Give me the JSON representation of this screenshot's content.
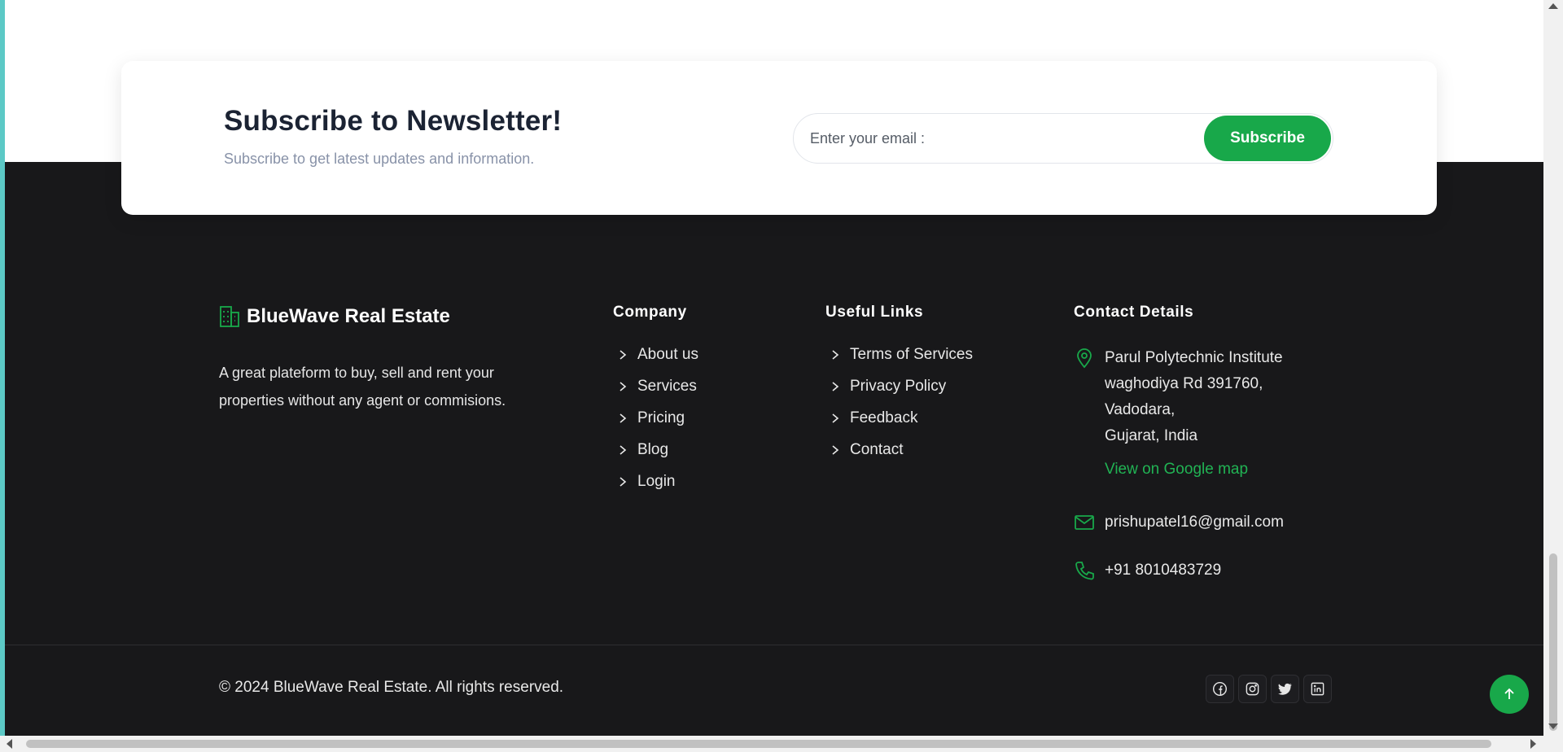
{
  "newsletter": {
    "title": "Subscribe to Newsletter!",
    "subtitle": "Subscribe to get latest updates and information.",
    "email_placeholder": "Enter your email :",
    "button_label": "Subscribe"
  },
  "brand": {
    "name": "BlueWave Real Estate",
    "icon": "building-icon",
    "description": "A great plateform to buy, sell and rent your properties without any agent or commisions."
  },
  "company": {
    "title": "Company",
    "links": [
      "About us",
      "Services",
      "Pricing",
      "Blog",
      "Login"
    ]
  },
  "useful_links": {
    "title": "Useful Links",
    "links": [
      "Terms of Services",
      "Privacy Policy",
      "Feedback",
      "Contact"
    ]
  },
  "contact": {
    "title": "Contact Details",
    "address_lines": [
      "Parul Polytechnic Institute",
      "waghodiya Rd 391760,",
      "Vadodara,",
      "Gujarat, India"
    ],
    "map_link": "View on Google map",
    "email": "prishupatel16@gmail.com",
    "phone": "+91 8010483729"
  },
  "footer_bottom": {
    "copyright": "© 2024 BlueWave Real Estate. All rights reserved.",
    "socials": [
      "facebook-icon",
      "instagram-icon",
      "twitter-icon",
      "linkedin-icon"
    ]
  },
  "colors": {
    "accent": "#18a84a",
    "footer_bg": "#18181a",
    "heading_dark": "#1b2333"
  }
}
